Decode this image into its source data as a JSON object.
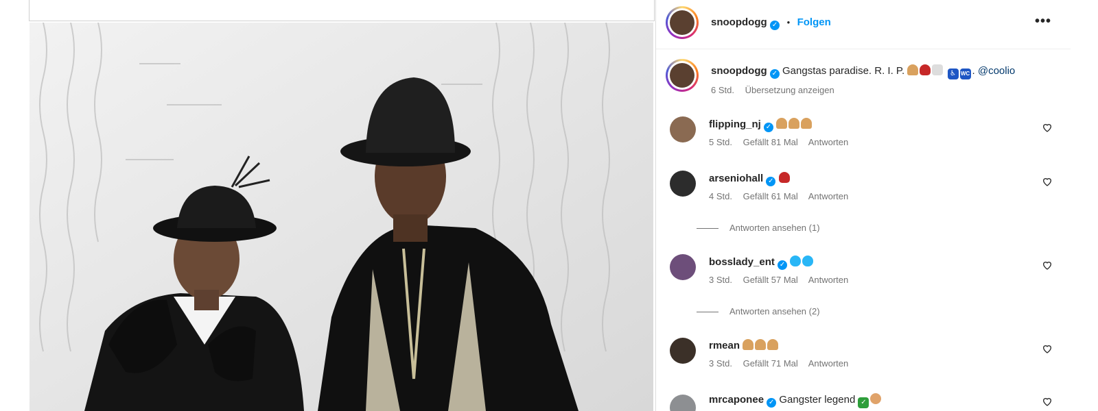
{
  "post": {
    "author": "snoopdogg",
    "follow_label": "Folgen",
    "more_icon": "more-icon",
    "caption": "Gangstas paradise. R. I. P.",
    "caption_mention": "@coolio",
    "caption_time": "6 Std.",
    "translate_label": "Übersetzung anzeigen"
  },
  "comments": [
    {
      "user": "flipping_nj",
      "text": "",
      "time": "5 Std.",
      "likes": "Gefällt 81 Mal",
      "reply": "Antworten"
    },
    {
      "user": "arseniohall",
      "text": "",
      "time": "4 Std.",
      "likes": "Gefällt 61 Mal",
      "reply": "Antworten",
      "view_replies": "Antworten ansehen (1)"
    },
    {
      "user": "bosslady_ent",
      "text": "",
      "time": "3 Std.",
      "likes": "Gefällt 57 Mal",
      "reply": "Antworten",
      "view_replies": "Antworten ansehen (2)"
    },
    {
      "user": "rmean",
      "text": "",
      "time": "3 Std.",
      "likes": "Gefällt 71 Mal",
      "reply": "Antworten"
    },
    {
      "user": "mrcaponee",
      "text": "Gangster legend"
    }
  ],
  "colors": {
    "accent": "#0095f6",
    "mention": "#00376b",
    "muted": "#737373"
  }
}
